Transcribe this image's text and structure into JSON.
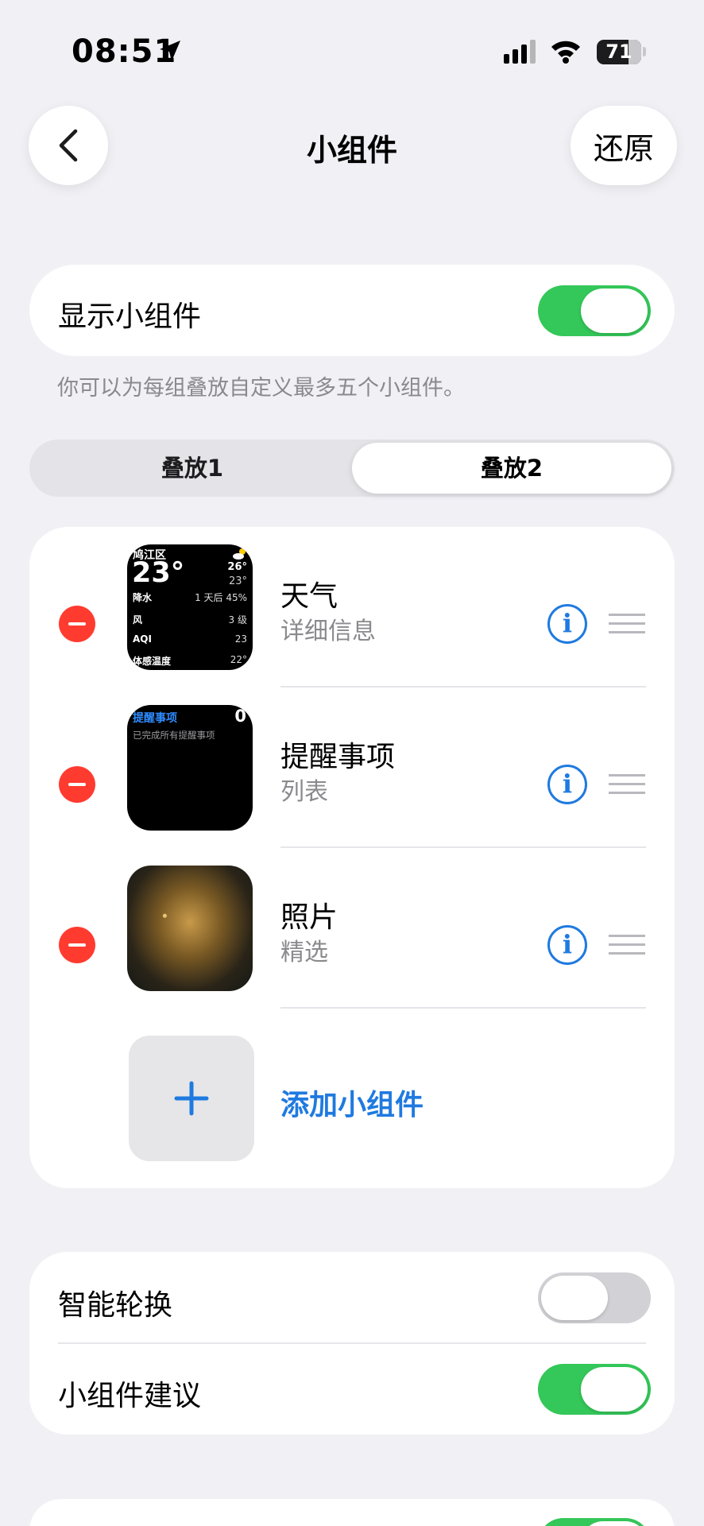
{
  "status_bar": {
    "time": "08:51",
    "battery": "71",
    "battery_level": 0.71
  },
  "nav": {
    "title": "小组件",
    "restore_label": "还原"
  },
  "show_widgets": {
    "label": "显示小组件",
    "enabled": true
  },
  "hint": "你可以为每组叠放自定义最多五个小组件。",
  "segments": {
    "stack1": "叠放1",
    "stack2": "叠放2",
    "selected": "叠放2"
  },
  "widgets": [
    {
      "title": "天气",
      "subtitle": "详细信息",
      "preview": {
        "location": "鸠江区",
        "temp": "23°",
        "high": "26°",
        "low": "23°",
        "rows": [
          {
            "label": "降水",
            "value": "1 天后 45%"
          },
          {
            "label": "风",
            "value": "3 级"
          },
          {
            "label": "AQI",
            "value": "23"
          },
          {
            "label": "体感温度",
            "value": "22°"
          }
        ]
      }
    },
    {
      "title": "提醒事项",
      "subtitle": "列表",
      "preview": {
        "title": "提醒事项",
        "count": "0",
        "subtitle": "已完成所有提醒事项"
      }
    },
    {
      "title": "照片",
      "subtitle": "精选"
    }
  ],
  "add_widget_label": "添加小组件",
  "settings": [
    {
      "label": "智能轮换",
      "enabled": false
    },
    {
      "label": "小组件建议",
      "enabled": true
    }
  ],
  "icons": [
    "chevron-left-icon",
    "location-arrow-icon",
    "signal-icon",
    "wifi-icon",
    "battery-icon",
    "info-icon",
    "drag-handle-icon",
    "minus-icon",
    "plus-icon",
    "weather-cloud-sun-icon"
  ],
  "colors": {
    "accent": "#1f7ae0",
    "toggle_on": "#34c759",
    "delete": "#ff3b30",
    "background": "#f0f0f5"
  }
}
